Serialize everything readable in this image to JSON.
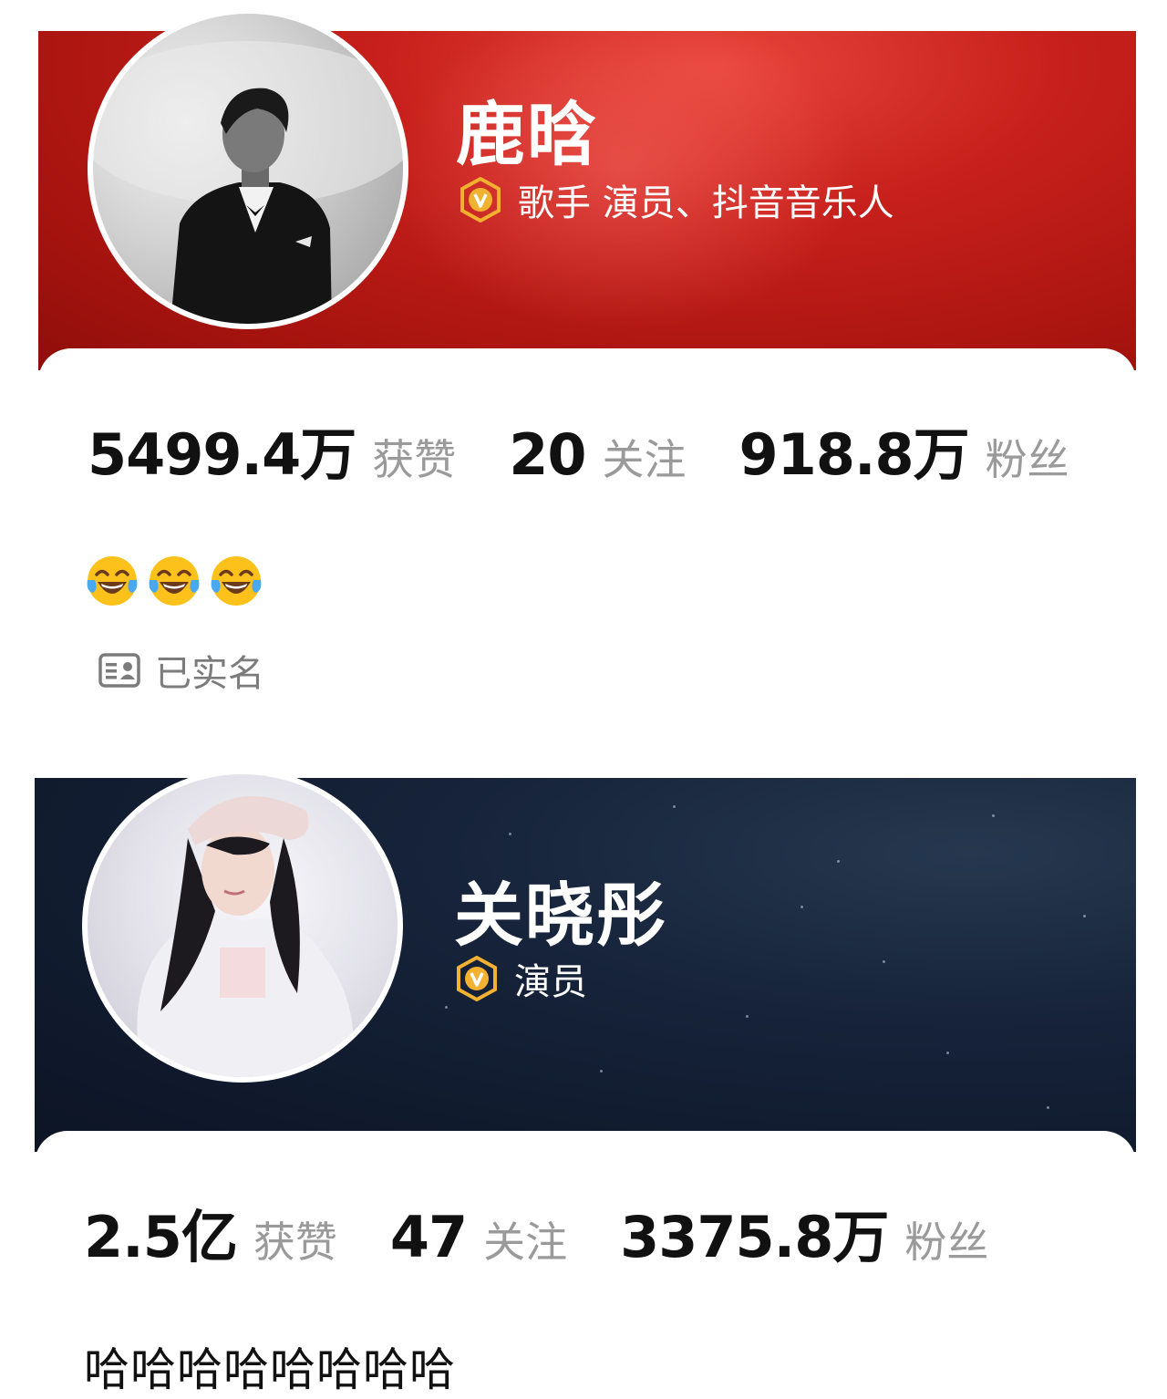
{
  "profiles": [
    {
      "name": "鹿晗",
      "verification": "歌手 演员、抖音音乐人",
      "stats": {
        "likes": {
          "value": "5499.4万",
          "label": "获赞"
        },
        "following": {
          "value": "20",
          "label": "关注"
        },
        "followers": {
          "value": "918.8万",
          "label": "粉丝"
        }
      },
      "bio_emoji": [
        "face-with-tears-of-joy",
        "face-with-tears-of-joy",
        "face-with-tears-of-joy"
      ],
      "realname_badge": "已实名",
      "banner_color": "#c8201c"
    },
    {
      "name": "关晓彤",
      "verification": "演员",
      "stats": {
        "likes": {
          "value": "2.5亿",
          "label": "获赞"
        },
        "following": {
          "value": "47",
          "label": "关注"
        },
        "followers": {
          "value": "3375.8万",
          "label": "粉丝"
        }
      },
      "bio": "哈哈哈哈哈哈哈哈",
      "banner_color": "#0c1424"
    }
  ],
  "colors": {
    "verify_badge": "#f2b130",
    "stat_label": "#9a9a9a"
  }
}
